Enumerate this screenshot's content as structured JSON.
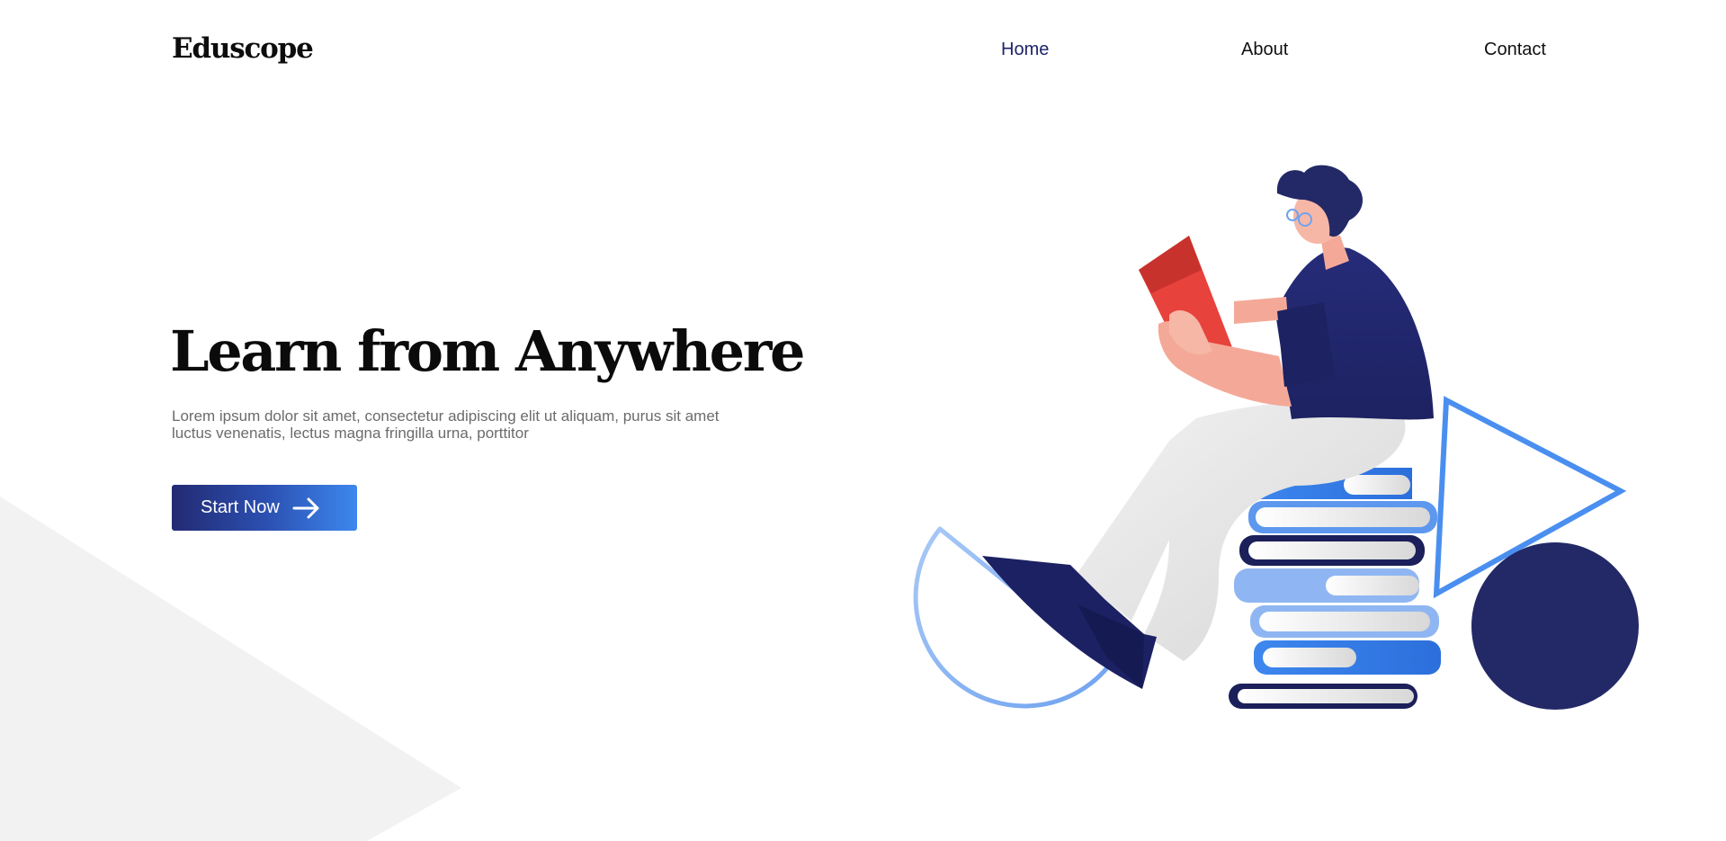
{
  "brand": {
    "logo_text": "Eduscope"
  },
  "nav": {
    "items": [
      {
        "label": "Home",
        "active": true
      },
      {
        "label": "About",
        "active": false
      },
      {
        "label": "Contact",
        "active": false
      }
    ]
  },
  "hero": {
    "title": "Learn from Anywhere",
    "description": "Lorem ipsum dolor sit amet, consectetur adipiscing elit ut aliquam, purus sit amet luctus venenatis, lectus magna fringilla urna, porttitor",
    "cta_label": "Start Now",
    "cta_icon": "arrow-right-icon"
  },
  "illustration": {
    "subject": "person-reading-on-books-icon",
    "shapes": [
      "half-circle-outline-icon",
      "triangle-outline-icon",
      "circle-icon",
      "book-stack-icon"
    ]
  },
  "colors": {
    "navy": "#232a72",
    "blue": "#3d87ee",
    "light_blue": "#8fb6f2",
    "red": "#e8423c",
    "skin": "#f4a998",
    "grey_bg": "#f2f2f2",
    "text_dark": "#0b0b0b",
    "text_muted": "#6b6b6b",
    "nav_active": "#1e2469"
  }
}
